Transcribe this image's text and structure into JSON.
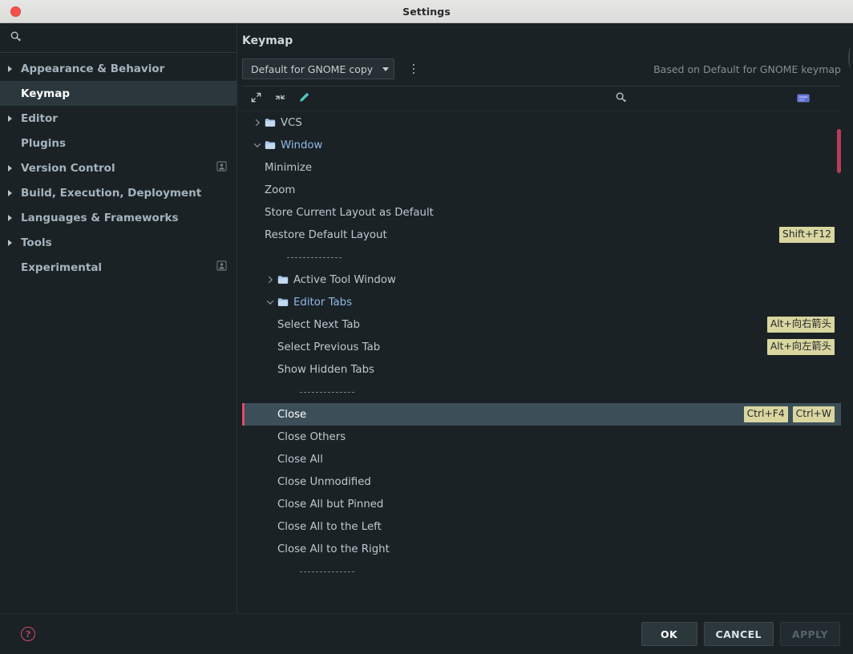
{
  "window": {
    "title": "Settings",
    "close_icon": "close-dot-icon"
  },
  "sidebar": {
    "search": {
      "value": "",
      "placeholder": "",
      "icon": "search-icon"
    },
    "items": [
      {
        "label": "Appearance & Behavior",
        "expandable": true,
        "selected": false,
        "badge": ""
      },
      {
        "label": "Keymap",
        "expandable": false,
        "selected": true,
        "badge": ""
      },
      {
        "label": "Editor",
        "expandable": true,
        "selected": false,
        "badge": ""
      },
      {
        "label": "Plugins",
        "expandable": false,
        "selected": false,
        "badge": ""
      },
      {
        "label": "Version Control",
        "expandable": true,
        "selected": false,
        "badge": "account-icon"
      },
      {
        "label": "Build, Execution, Deployment",
        "expandable": true,
        "selected": false,
        "badge": ""
      },
      {
        "label": "Languages & Frameworks",
        "expandable": true,
        "selected": false,
        "badge": ""
      },
      {
        "label": "Tools",
        "expandable": true,
        "selected": false,
        "badge": ""
      },
      {
        "label": "Experimental",
        "expandable": false,
        "selected": false,
        "badge": "account-icon"
      }
    ]
  },
  "main": {
    "page_title": "Keymap",
    "keymap_select": {
      "value": "Default for GNOME copy",
      "caret": "chevron-down-icon"
    },
    "kebab_label": "more-options",
    "based_on": "Based on Default for GNOME keymap",
    "toolbar": {
      "expand_all": "expand-all-icon",
      "collapse_all": "collapse-all-icon",
      "edit": "edit-pencil-icon",
      "search": "search-icon",
      "keyboard": "keyboard-icon"
    }
  },
  "tree": {
    "rows": [
      {
        "type": "folder",
        "label": "VCS",
        "indent": 0,
        "state": "collapsed",
        "selected": false,
        "shortcuts": []
      },
      {
        "type": "folder",
        "label": "Window",
        "indent": 0,
        "state": "expanded",
        "selected": false,
        "shortcuts": []
      },
      {
        "type": "action",
        "label": "Minimize",
        "indent": 1,
        "state": "",
        "selected": false,
        "shortcuts": []
      },
      {
        "type": "action",
        "label": "Zoom",
        "indent": 1,
        "state": "",
        "selected": false,
        "shortcuts": []
      },
      {
        "type": "action",
        "label": "Store Current Layout as Default",
        "indent": 1,
        "state": "",
        "selected": false,
        "shortcuts": []
      },
      {
        "type": "action",
        "label": "Restore Default Layout",
        "indent": 1,
        "state": "",
        "selected": false,
        "shortcuts": [
          "Shift+F12"
        ]
      },
      {
        "type": "separator",
        "label": "",
        "indent": 1,
        "state": "",
        "selected": false,
        "shortcuts": []
      },
      {
        "type": "folder",
        "label": "Active Tool Window",
        "indent": 1,
        "state": "collapsed",
        "selected": false,
        "shortcuts": []
      },
      {
        "type": "folder",
        "label": "Editor Tabs",
        "indent": 1,
        "state": "expanded",
        "selected": false,
        "shortcuts": []
      },
      {
        "type": "action",
        "label": "Select Next Tab",
        "indent": 2,
        "state": "",
        "selected": false,
        "shortcuts": [
          "Alt+向右箭头"
        ]
      },
      {
        "type": "action",
        "label": "Select Previous Tab",
        "indent": 2,
        "state": "",
        "selected": false,
        "shortcuts": [
          "Alt+向左箭头"
        ]
      },
      {
        "type": "action",
        "label": "Show Hidden Tabs",
        "indent": 2,
        "state": "",
        "selected": false,
        "shortcuts": []
      },
      {
        "type": "separator",
        "label": "",
        "indent": 2,
        "state": "",
        "selected": false,
        "shortcuts": []
      },
      {
        "type": "action",
        "label": "Close",
        "indent": 2,
        "state": "",
        "selected": true,
        "shortcuts": [
          "Ctrl+F4",
          "Ctrl+W"
        ]
      },
      {
        "type": "action",
        "label": "Close Others",
        "indent": 2,
        "state": "",
        "selected": false,
        "shortcuts": []
      },
      {
        "type": "action",
        "label": "Close All",
        "indent": 2,
        "state": "",
        "selected": false,
        "shortcuts": []
      },
      {
        "type": "action",
        "label": "Close Unmodified",
        "indent": 2,
        "state": "",
        "selected": false,
        "shortcuts": []
      },
      {
        "type": "action",
        "label": "Close All but Pinned",
        "indent": 2,
        "state": "",
        "selected": false,
        "shortcuts": []
      },
      {
        "type": "action",
        "label": "Close All to the Left",
        "indent": 2,
        "state": "",
        "selected": false,
        "shortcuts": []
      },
      {
        "type": "action",
        "label": "Close All to the Right",
        "indent": 2,
        "state": "",
        "selected": false,
        "shortcuts": []
      },
      {
        "type": "separator",
        "label": "",
        "indent": 2,
        "state": "",
        "selected": false,
        "shortcuts": []
      }
    ]
  },
  "footer": {
    "help_icon": "help-icon",
    "help_glyph": "?",
    "buttons": [
      {
        "label": "OK",
        "style": "primary"
      },
      {
        "label": "CANCEL",
        "style": "normal"
      },
      {
        "label": "APPLY",
        "style": "disabled"
      }
    ]
  },
  "colors": {
    "background": "#1b2225",
    "selection": "#3c4f58",
    "selection_marker": "#e14a6a",
    "folder_text": "#8fb7e8",
    "shortcut_badge": "#d9d6a0",
    "titlebar": "#e6e6e4",
    "close_dot": "#f2504b",
    "scrollbar_thumb": "#c6435f",
    "accent_teal": "#4ec9c0"
  }
}
